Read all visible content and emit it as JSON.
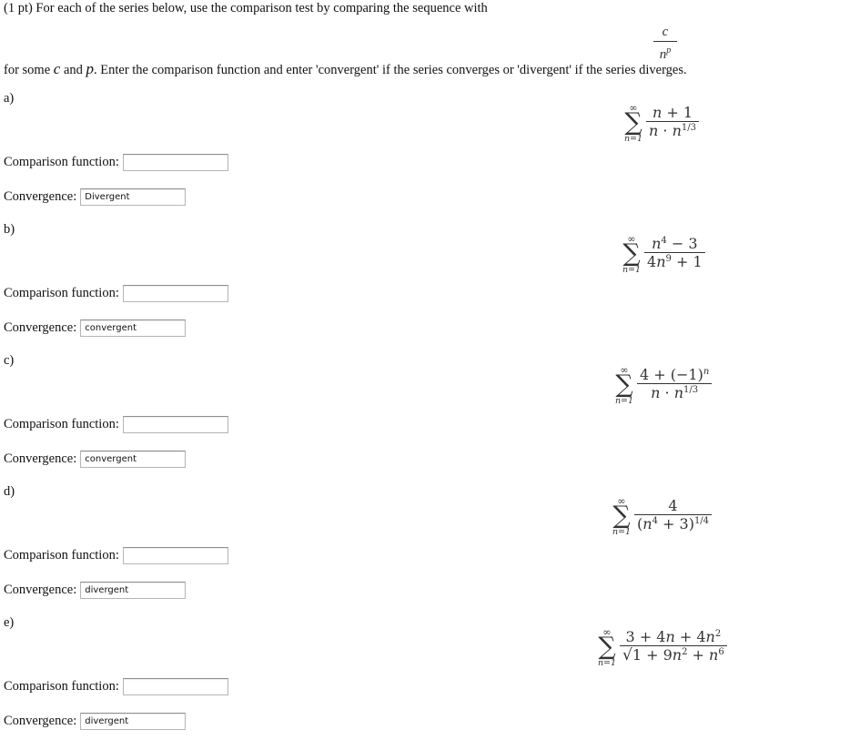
{
  "intro": {
    "line1": "(1 pt) For each of the series below, use the comparison test by comparing the sequence with",
    "fraction": {
      "numerator": "c",
      "denominator_base": "n",
      "denominator_exp": "p"
    },
    "line2_a": "for some ",
    "line2_c": "c",
    "line2_b": " and ",
    "line2_p": "p",
    "line2_rest": ". Enter the comparison function and enter 'convergent' if the series converges or 'divergent' if the series diverges."
  },
  "labels": {
    "comparison": "Comparison function:",
    "convergence": "Convergence:"
  },
  "sigma": {
    "upper": "∞",
    "symbol": "∑",
    "lower": "n=1"
  },
  "problems": [
    {
      "part": "a)",
      "series_text": "sum_{n=1}^{inf} (n+1)/(n·n^(1/3))",
      "comparison_value": "",
      "convergence_value": "Divergent"
    },
    {
      "part": "b)",
      "series_text": "sum_{n=1}^{inf} (n^4-3)/(4n^9+1)",
      "comparison_value": "",
      "convergence_value": "convergent"
    },
    {
      "part": "c)",
      "series_text": "sum_{n=1}^{inf} (4+(-1)^n)/(n·n^(1/3))",
      "comparison_value": "",
      "convergence_value": "convergent"
    },
    {
      "part": "d)",
      "series_text": "sum_{n=1}^{inf} 4/(n^4+3)^(1/4)",
      "comparison_value": "",
      "convergence_value": "divergent"
    },
    {
      "part": "e)",
      "series_text": "sum_{n=1}^{inf} (3+4n+4n^2)/sqrt(1+9n^2+n^6)",
      "comparison_value": "",
      "convergence_value": "divergent"
    }
  ]
}
